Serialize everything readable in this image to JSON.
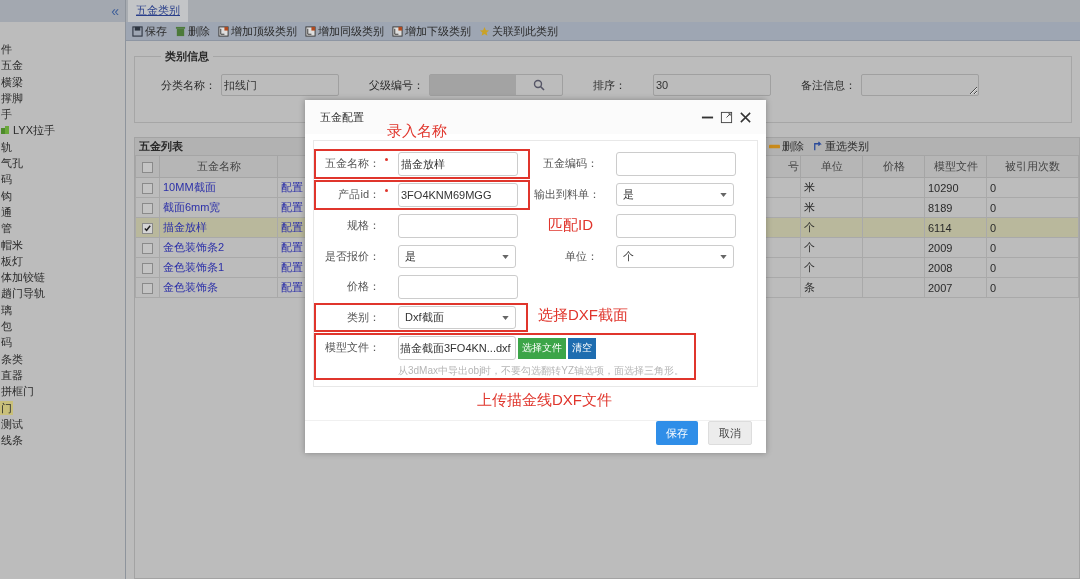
{
  "sidebar": {
    "collapse_icon": "«",
    "items": [
      {
        "label": "件",
        "kind": "plain",
        "selected": false
      },
      {
        "label": "五金",
        "kind": "plain",
        "selected": false
      },
      {
        "label": "横梁",
        "kind": "plain",
        "selected": false
      },
      {
        "label": "撑脚",
        "kind": "plain",
        "selected": false
      },
      {
        "label": "手",
        "kind": "plain",
        "selected": false
      },
      {
        "label": "LYX拉手",
        "kind": "icon",
        "selected": false
      },
      {
        "label": "轨",
        "kind": "plain",
        "selected": false
      },
      {
        "label": "气孔",
        "kind": "plain",
        "selected": false
      },
      {
        "label": "码",
        "kind": "plain",
        "selected": false
      },
      {
        "label": "钩",
        "kind": "plain",
        "selected": false
      },
      {
        "label": "通",
        "kind": "plain",
        "selected": false
      },
      {
        "label": "管",
        "kind": "plain",
        "selected": false
      },
      {
        "label": "帽米",
        "kind": "plain",
        "selected": false
      },
      {
        "label": "板灯",
        "kind": "plain",
        "selected": false
      },
      {
        "label": "体加铰链",
        "kind": "plain",
        "selected": false
      },
      {
        "label": "趟门导轨",
        "kind": "plain",
        "selected": false
      },
      {
        "label": "璃",
        "kind": "plain",
        "selected": false
      },
      {
        "label": "包",
        "kind": "plain",
        "selected": false
      },
      {
        "label": "码",
        "kind": "plain",
        "selected": false
      },
      {
        "label": "条类",
        "kind": "plain",
        "selected": false
      },
      {
        "label": "直器",
        "kind": "plain",
        "selected": false
      },
      {
        "label": "拼框门",
        "kind": "plain",
        "selected": false
      },
      {
        "label": "门",
        "kind": "plain",
        "selected": true
      },
      {
        "label": "测试",
        "kind": "plain",
        "selected": false
      },
      {
        "label": "线条",
        "kind": "plain",
        "selected": false
      }
    ]
  },
  "tabs": [
    {
      "label": "五金类别",
      "selected": true
    }
  ],
  "toolbar": [
    {
      "label": "保存",
      "kind": "save"
    },
    {
      "label": "删除",
      "kind": "trash"
    },
    {
      "label": "增加顶级类别",
      "kind": "add"
    },
    {
      "label": "增加同级类别",
      "kind": "add"
    },
    {
      "label": "增加下级类别",
      "kind": "add"
    },
    {
      "label": "关联到此类别",
      "kind": "link"
    }
  ],
  "category_info": {
    "legend": "类别信息",
    "fields": [
      {
        "label": "分类名称：",
        "kind": "text",
        "value": "扣线门"
      },
      {
        "label": "父级编号：",
        "kind": "lookup"
      },
      {
        "label": "排序：",
        "kind": "text",
        "value": "30"
      },
      {
        "label": "备注信息：",
        "kind": "textarea"
      }
    ]
  },
  "list": {
    "title": "五金列表",
    "actions": [
      {
        "label": "删除",
        "kind": "remove"
      },
      {
        "label": "重选类别",
        "kind": "reselect"
      }
    ],
    "columns": [
      {
        "label": "五金名称"
      },
      {
        "label": "号"
      },
      {
        "label": "单位"
      },
      {
        "label": "价格"
      },
      {
        "label": "模型文件"
      },
      {
        "label": "被引用次数"
      }
    ],
    "header_checked": false,
    "rows": [
      {
        "name": "10MM截面",
        "column_3": "配置",
        "unit": "米",
        "model": "10290",
        "refs": "0",
        "checked": false,
        "selected": false
      },
      {
        "name": "截面6mm宽",
        "column_3": "配置",
        "unit": "米",
        "model": "8189",
        "refs": "0",
        "checked": false,
        "selected": false
      },
      {
        "name": "描金放样",
        "column_3": "配置",
        "unit": "个",
        "model": "6114",
        "refs": "0",
        "checked": true,
        "selected": true
      },
      {
        "name": "金色装饰条2",
        "column_3": "配置",
        "unit": "个",
        "model": "2009",
        "refs": "0",
        "checked": false,
        "selected": false
      },
      {
        "name": "金色装饰条1",
        "column_3": "配置",
        "unit": "个",
        "model": "2008",
        "refs": "0",
        "checked": false,
        "selected": false
      },
      {
        "name": "金色装饰条",
        "column_3": "配置",
        "unit": "条",
        "model": "2007",
        "refs": "0",
        "checked": false,
        "selected": false
      }
    ]
  },
  "dialog": {
    "title": "五金配置",
    "top_note": "录入名称",
    "rows": [
      {
        "fields": [
          {
            "label": "五金名称：",
            "required": true,
            "kind": "text",
            "value": "描金放样",
            "highlighted": true
          },
          {
            "label": "五金编码：",
            "required": false,
            "kind": "text",
            "highlighted": false
          }
        ]
      },
      {
        "fields": [
          {
            "label": "产品id：",
            "required": true,
            "kind": "text",
            "value": "3FO4KNM69MGG",
            "highlighted": true
          },
          {
            "label": "输出到料单：",
            "required": false,
            "kind": "select",
            "value": "是",
            "highlighted": false
          }
        ]
      },
      {
        "fields": [
          {
            "label": "规格：",
            "required": false,
            "kind": "text",
            "highlighted": false
          },
          {
            "note": "匹配ID",
            "required": false,
            "kind": "text",
            "highlighted": false
          }
        ]
      },
      {
        "fields": [
          {
            "label": "是否报价：",
            "required": false,
            "kind": "select",
            "value": "是",
            "highlighted": false
          },
          {
            "label": "单位：",
            "required": false,
            "kind": "select",
            "value": "个",
            "highlighted": false
          }
        ]
      },
      {
        "fields": [
          {
            "label": "价格：",
            "required": false,
            "kind": "text",
            "highlighted": false
          }
        ]
      },
      {
        "fields": [
          {
            "label": "类别：",
            "required": false,
            "kind": "select",
            "value": "Dxf截面",
            "highlighted": true
          }
        ],
        "note": "选择DXF截面"
      },
      {
        "fields": [
          {
            "label": "模型文件：",
            "required": false,
            "kind": "file",
            "value": "描金截面3FO4KN...dxf",
            "choose": "选择文件",
            "clear": "清空",
            "hint": "从3dMax中导出obj时，不要勾选翻转YZ轴选项，面选择三角形。",
            "highlighted": true
          }
        ]
      }
    ],
    "bottom_note": "上传描金线DXF文件",
    "buttons": [
      {
        "label": "保存",
        "kind": "primary"
      },
      {
        "label": "取消",
        "kind": "default"
      }
    ]
  }
}
